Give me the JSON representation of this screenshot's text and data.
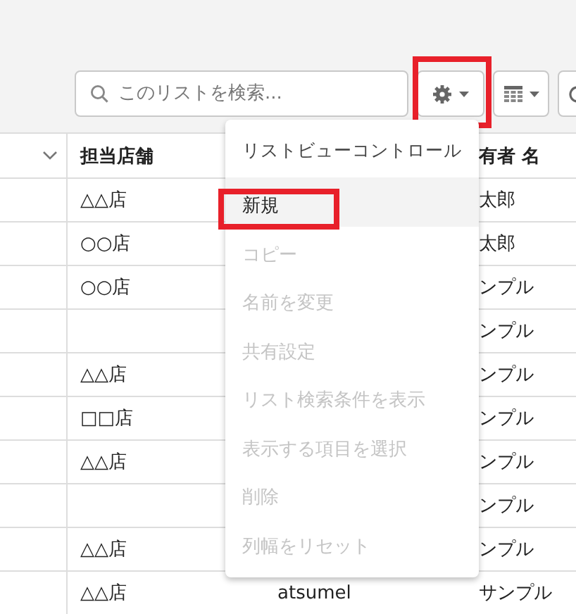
{
  "toolbar": {
    "search": {
      "placeholder": "このリストを検索..."
    },
    "settings_button": {
      "highlighted": true
    }
  },
  "table": {
    "header": {
      "store": "担当店舗",
      "owner": "有者 名"
    },
    "rows": [
      {
        "store": "△△店",
        "owner": "太郎"
      },
      {
        "store": "○○店",
        "owner": "太郎"
      },
      {
        "store": "○○店",
        "owner": "ンプル"
      },
      {
        "owner": "ンプル"
      },
      {
        "store": "△△店",
        "owner": "ンプル"
      },
      {
        "store": "□□店",
        "owner": "ンプル"
      },
      {
        "store": "△△店",
        "owner": "ンプル"
      },
      {
        "owner": "ンプル"
      },
      {
        "store": "△△店",
        "owner": "ンプル"
      },
      {
        "store": "△△店",
        "column_3": "atsumel",
        "owner": "サンプル"
      }
    ]
  },
  "menu": {
    "title": "リストビューコントロール",
    "items": [
      {
        "label": "新規",
        "disabled": false,
        "hovered": true,
        "highlighted": true
      },
      {
        "label": "コピー",
        "disabled": true,
        "hovered": false,
        "highlighted": false
      },
      {
        "label": "名前を変更",
        "disabled": true,
        "hovered": false,
        "highlighted": false
      },
      {
        "label": "共有設定",
        "disabled": true,
        "hovered": false,
        "highlighted": false
      },
      {
        "label": "リスト検索条件を表示",
        "disabled": true,
        "hovered": false,
        "highlighted": false
      },
      {
        "label": "表示する項目を選択",
        "disabled": true,
        "hovered": false,
        "highlighted": false
      },
      {
        "label": "削除",
        "disabled": true,
        "hovered": false,
        "highlighted": false
      },
      {
        "label": "列幅をリセット",
        "disabled": true,
        "hovered": false,
        "highlighted": false
      }
    ]
  }
}
